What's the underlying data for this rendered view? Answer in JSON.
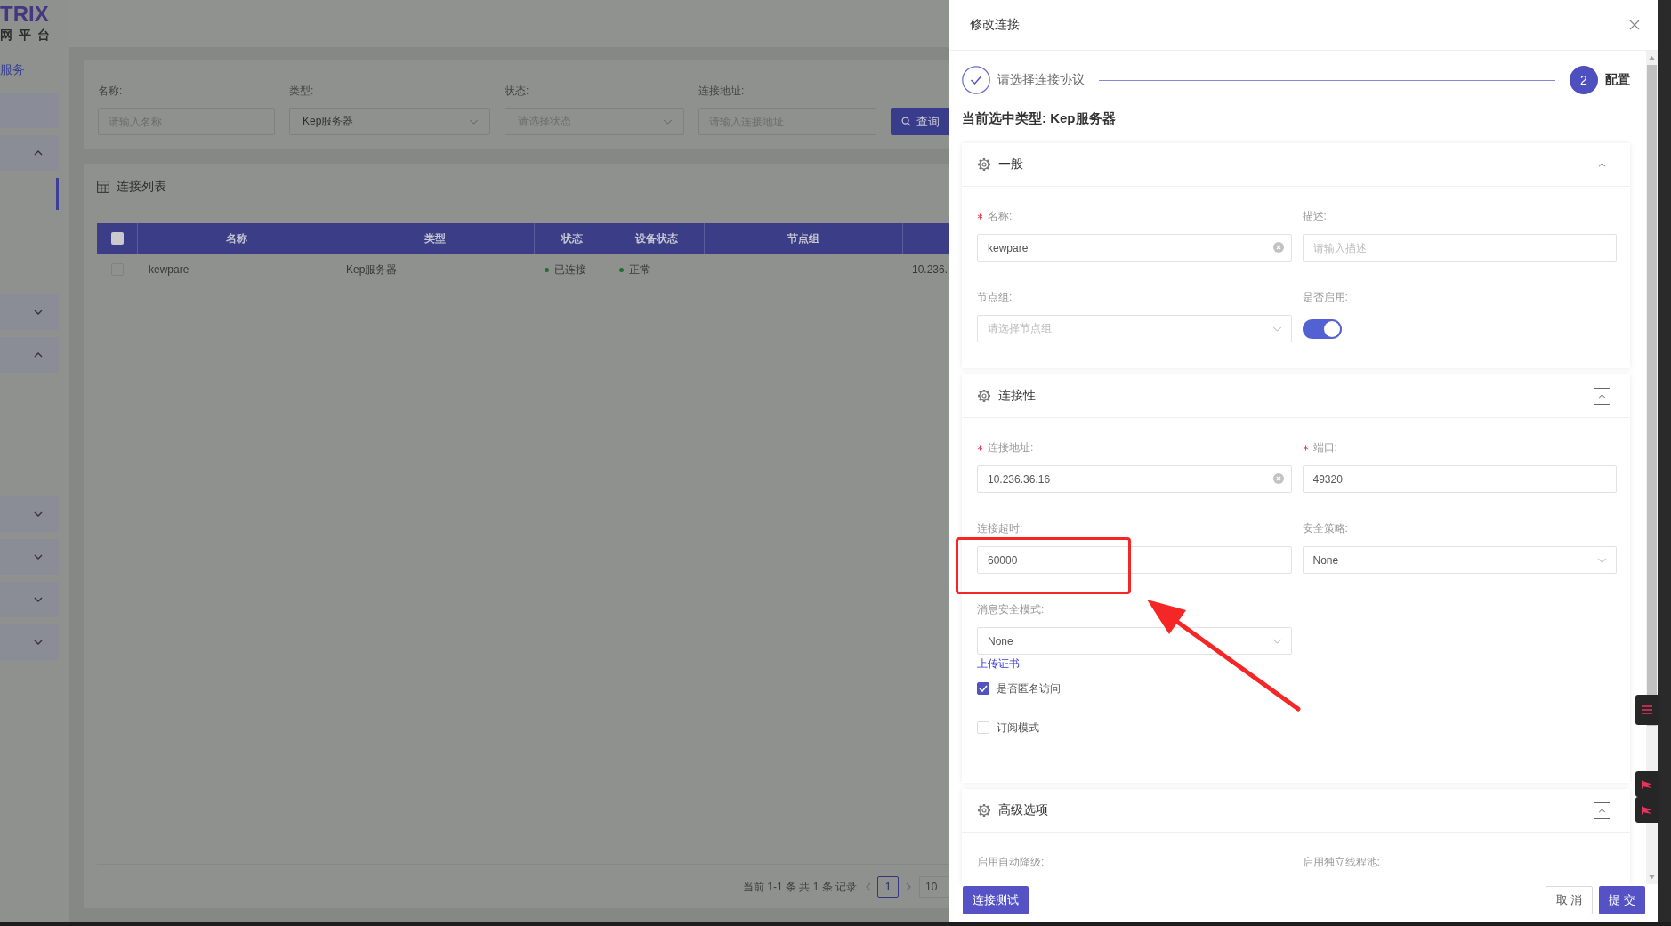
{
  "sidebar": {
    "logo": "TRIX",
    "logo_subtitle": "网平台",
    "section_label": "服务",
    "items": [
      {
        "kind": "link",
        "selected": false
      },
      {
        "kind": "group",
        "expanded": true,
        "children": [
          {
            "selected": true
          },
          {
            "selected": false
          },
          {
            "selected": false
          }
        ]
      },
      {
        "kind": "group",
        "expanded": false
      },
      {
        "kind": "group",
        "expanded": true,
        "children": [
          {
            "selected": false
          },
          {
            "selected": false
          },
          {
            "selected": false
          }
        ]
      },
      {
        "kind": "group",
        "expanded": false
      },
      {
        "kind": "group",
        "expanded": false
      },
      {
        "kind": "group",
        "expanded": false
      },
      {
        "kind": "group",
        "expanded": false
      }
    ]
  },
  "filters": {
    "fields": [
      {
        "kind": "input",
        "label": "名称:",
        "placeholder": "请输入名称"
      },
      {
        "kind": "select",
        "label": "类型:",
        "value": "Kep服务器"
      },
      {
        "kind": "select",
        "label": "状态:",
        "placeholder": "请选择状态"
      },
      {
        "kind": "input",
        "label": "连接地址:",
        "placeholder": "请输入连接地址"
      }
    ],
    "query_button": "查询"
  },
  "table": {
    "title": "连接列表",
    "header_checked": false,
    "columns": [
      "名称",
      "类型",
      "状态",
      "设备状态",
      "节点组"
    ],
    "rows": [
      {
        "checked": false,
        "name": "kewpare",
        "type": "Kep服务器",
        "status": {
          "label": "已连接",
          "color": "#1f6e33"
        },
        "device_status": {
          "label": "正常",
          "color": "#1f6e33"
        },
        "column_6": "10.236."
      }
    ]
  },
  "pagination": {
    "summary": "当前 1-1 条 共 1 条 记录",
    "pages": [
      {
        "label": "1",
        "selected": true
      }
    ],
    "page_size": "10"
  },
  "drawer": {
    "title": "修改连接",
    "steps": [
      {
        "completed": true,
        "label": "请选择连接协议"
      },
      {
        "completed": false,
        "number": "2",
        "label": "配置"
      }
    ],
    "current_type": "当前选中类型: Kep服务器",
    "sections": [
      {
        "title": "一般",
        "expanded": true,
        "fields": [
          {
            "kind": "input",
            "label": "名称:",
            "required": true,
            "value": "kewpare",
            "clearable": true
          },
          {
            "kind": "input",
            "label": "描述:",
            "required": false,
            "placeholder": "请输入描述",
            "clearable": false
          },
          {
            "kind": "select",
            "label": "节点组:",
            "required": false,
            "placeholder": "请选择节点组"
          },
          {
            "kind": "switch",
            "label": "是否启用:",
            "required": false,
            "on": true
          }
        ]
      },
      {
        "title": "连接性",
        "expanded": true,
        "fields": [
          {
            "kind": "input",
            "label": "连接地址:",
            "required": true,
            "value": "10.236.36.16",
            "clearable": true
          },
          {
            "kind": "input",
            "label": "端口:",
            "required": true,
            "value": "49320",
            "clearable": false
          },
          {
            "kind": "input",
            "label": "连接超时:",
            "required": false,
            "value": "60000",
            "clearable": false
          },
          {
            "kind": "select",
            "label": "安全策略:",
            "required": false,
            "value": "None"
          },
          {
            "kind": "select",
            "label": "消息安全模式:",
            "required": false,
            "value": "None"
          }
        ],
        "extras": [
          {
            "kind": "link",
            "label": "上传证书"
          },
          {
            "kind": "checkbox",
            "label": "是否匿名访问",
            "checked": true
          },
          {
            "kind": "checkbox",
            "label": "订阅模式",
            "checked": false
          }
        ]
      },
      {
        "title": "高级选项",
        "expanded": true,
        "fields": [
          {
            "kind": "clipped",
            "label": "启用自动降级:",
            "required": false
          },
          {
            "kind": "clipped",
            "label": "启用独立线程池:",
            "required": false
          }
        ]
      }
    ],
    "footer": {
      "left_buttons": [
        {
          "label": "连接测试",
          "kind": "primary"
        }
      ],
      "right_buttons": [
        {
          "label": "取 消",
          "kind": "default"
        },
        {
          "label": "提 交",
          "kind": "primary"
        }
      ]
    }
  },
  "side_tools": [
    {
      "kind": "menu"
    },
    {
      "kind": "flag"
    },
    {
      "kind": "flag"
    }
  ]
}
